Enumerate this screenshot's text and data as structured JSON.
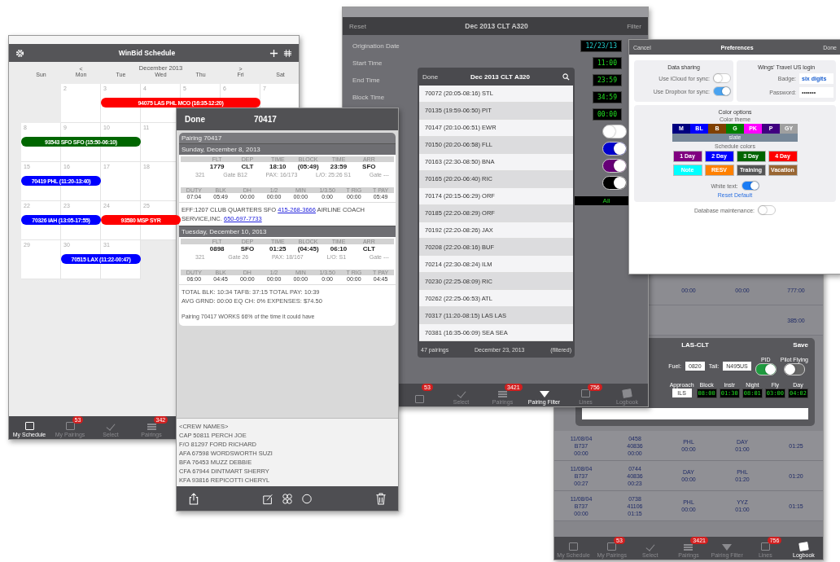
{
  "logbook": {
    "summary_rows": [
      {
        "values": [
          "00:00",
          "00:00",
          "777:00"
        ]
      },
      {
        "values": [
          "385:00"
        ]
      }
    ],
    "dialog": {
      "title": "LAS-CLT",
      "save": "Save",
      "fields": [
        {
          "label": "Fuel:",
          "value": "0820"
        },
        {
          "label": "Tail:",
          "value": "N495US"
        }
      ],
      "switches": [
        {
          "label": "PID",
          "on": true
        },
        {
          "label": "Pilot Flying",
          "on": false
        }
      ],
      "times": [
        {
          "kind": "field",
          "label": "Approach",
          "value": "ILS"
        },
        {
          "kind": "digital",
          "label": "Block",
          "value": "08:00"
        },
        {
          "kind": "digital",
          "label": "Instr",
          "value": "01:30"
        },
        {
          "kind": "digital",
          "label": "Night",
          "value": "08:01"
        },
        {
          "kind": "digital",
          "label": "Fly",
          "value": "03:00"
        },
        {
          "kind": "digital",
          "label": "Day",
          "value": "04:02"
        }
      ]
    },
    "rows": [
      {
        "cells": [
          [
            "11/08/04",
            "B737",
            "00:00"
          ],
          [
            "0458",
            "40836",
            "00:00"
          ],
          [
            "PHL",
            "00:00"
          ],
          [
            "DAY",
            "01:00"
          ],
          [
            "01:25"
          ]
        ]
      },
      {
        "cells": [
          [
            "11/08/04",
            "B737",
            "00:27"
          ],
          [
            "0744",
            "40836",
            "00:23"
          ],
          [
            "DAY",
            "00:00"
          ],
          [
            "PHL",
            "01:20"
          ],
          [
            "01:20"
          ]
        ]
      },
      {
        "cells": [
          [
            "11/08/04",
            "B737",
            "00:00"
          ],
          [
            "0738",
            "41106",
            "01:15"
          ],
          [
            "PHL",
            "00:00"
          ],
          [
            "YYZ",
            "01:00"
          ],
          [
            "01:15"
          ]
        ]
      }
    ],
    "tab_bar": [
      {
        "kind": "schedule",
        "label": "My Schedule",
        "selected": false
      },
      {
        "kind": "pairings",
        "label": "My Pairings",
        "badge": "53",
        "selected": false
      },
      {
        "kind": "select",
        "label": "Select",
        "selected": false
      },
      {
        "kind": "list",
        "label": "Pairings",
        "badge": "3421",
        "selected": false
      },
      {
        "kind": "filter",
        "label": "Pairing Filter",
        "selected": false
      },
      {
        "kind": "lines",
        "label": "Lines",
        "badge": "756",
        "selected": false
      },
      {
        "kind": "logbook",
        "label": "Logbook",
        "selected": true
      }
    ]
  },
  "filter_screen": {
    "reset": "Reset",
    "title": "Dec 2013 CLT A320",
    "filter": "Filter",
    "fields": [
      {
        "label": "Origination Date",
        "value": "12/23/13"
      },
      {
        "label": "Start Time",
        "value": "11:00"
      },
      {
        "label": "End Time",
        "value": "23:59"
      },
      {
        "label": "Block Time",
        "value": "34:59"
      },
      {
        "value": "00:00"
      }
    ],
    "switches": [
      {
        "on": false
      },
      {
        "on": true,
        "color": "#0000cc"
      },
      {
        "on": true,
        "color": "#660077"
      },
      {
        "on": true,
        "color": "#000000"
      }
    ],
    "all_button": "All",
    "pairing_list": {
      "done": "Done",
      "title": "Dec 2013 CLT A320",
      "rows": [
        "70072 (20:05-08:16) STL",
        "70135 (19:59-06:50) PIT",
        "70147 (20:10-06:51) EWR",
        "70150 (20:20-06:58) FLL",
        "70163 (22:30-08:50) BNA",
        "70165 (20:20-06:40) RIC",
        "70174 (20:15-06:29) ORF",
        "70185 (22:20-08:29) ORF",
        "70192 (22:20-08:26) JAX",
        "70208 (22:20-08:16) BUF",
        "70214 (22:30-08:24) ILM",
        "70230 (22:25-08:09) RIC",
        "70262 (22:25-06:53) ATL",
        "70317 (11:20-08:15) LAS LAS",
        "70381 (16:35-06:09) SEA SEA"
      ],
      "count": "47 pairings",
      "date": "December 23, 2013",
      "status": "(filtered)"
    },
    "tab_bar": [
      {
        "kind": "pairings",
        "badge": "53",
        "selected": false
      },
      {
        "kind": "select",
        "label": "Select",
        "selected": false
      },
      {
        "kind": "list",
        "label": "Pairings",
        "badge": "3421",
        "selected": false
      },
      {
        "kind": "filter",
        "label": "Pairing Filter",
        "selected": true
      },
      {
        "kind": "lines",
        "label": "Lines",
        "badge": "756",
        "selected": false
      },
      {
        "kind": "logbook",
        "label": "Logbook",
        "selected": false
      }
    ]
  },
  "calendar": {
    "title": "WinBid Schedule",
    "prev": "<",
    "month": "December 2013",
    "next": ">",
    "weekdays": [
      "Sun",
      "Mon",
      "Tue",
      "Wed",
      "Thu",
      "Fri",
      "Sat"
    ],
    "weeks": [
      {
        "cells": [
          {
            "kind": "blank"
          },
          {
            "kind": "day",
            "day": "2"
          },
          {
            "kind": "day",
            "day": "3",
            "bar": {
              "label": "94075 LAS PHL MCO (16:35-12:20)",
              "color": "#ff0000"
            }
          },
          {
            "kind": "day",
            "day": "4",
            "bar_continues": true
          },
          {
            "kind": "day",
            "day": "5",
            "bar_continues": true
          },
          {
            "kind": "day",
            "day": "6",
            "bar_continues": true
          },
          {
            "kind": "day",
            "day": "7"
          }
        ]
      },
      {
        "cells": [
          {
            "kind": "day",
            "day": "8",
            "bar": {
              "label": "93543 SFO SFO (15:50-06:10)",
              "color": "#006600"
            }
          },
          {
            "kind": "day",
            "day": "9",
            "bar_continues": true
          },
          {
            "kind": "day",
            "day": "10",
            "bar_continues": true
          },
          {
            "kind": "day",
            "day": "11"
          }
        ]
      },
      {
        "cells": [
          {
            "kind": "day",
            "day": "15",
            "bar": {
              "label": "70419 PHL (11:20-13:40)",
              "color": "#0000ff"
            }
          },
          {
            "kind": "day",
            "day": "16",
            "bar_continues": true
          },
          {
            "kind": "day",
            "day": "17"
          },
          {
            "kind": "day",
            "day": "18"
          }
        ]
      },
      {
        "cells": [
          {
            "kind": "day",
            "day": "22",
            "bar": {
              "label": "70326 IAH (13:05-17:55)",
              "color": "#0000ff"
            }
          },
          {
            "kind": "day",
            "day": "23",
            "bar_continues": true
          },
          {
            "kind": "day",
            "day": "24",
            "bar": {
              "label": "93580 MSP SYR",
              "color": "#ff0000"
            }
          },
          {
            "kind": "day",
            "day": "25",
            "bar_continues": true
          }
        ]
      },
      {
        "cells": [
          {
            "kind": "day",
            "day": "29"
          },
          {
            "kind": "day",
            "day": "30",
            "bar": {
              "label": "70515 LAX (11:22-00:47)",
              "color": "#0000ff"
            }
          },
          {
            "kind": "day",
            "day": "31",
            "bar_continues": true
          },
          {
            "kind": "blank"
          },
          {
            "kind": "blank"
          },
          {
            "kind": "blank"
          },
          {
            "kind": "blank"
          }
        ]
      }
    ],
    "tab_bar": [
      {
        "kind": "schedule",
        "label": "My Schedule",
        "selected": true
      },
      {
        "kind": "pairings",
        "label": "My Pairings",
        "badge": "53",
        "selected": false
      },
      {
        "kind": "select",
        "label": "Select",
        "selected": false
      },
      {
        "kind": "list",
        "label": "Pairings",
        "badge": "342",
        "selected": false
      }
    ]
  },
  "pairing_detail": {
    "done": "Done",
    "title": "70417",
    "pairing": "Pairing 70417",
    "days": [
      {
        "date": "Sunday, December 8, 2013",
        "leg_headers": [
          "FLT",
          "DEP",
          "TIME",
          "BLOCK",
          "TIME",
          "ARR"
        ],
        "leg": [
          "1779",
          "CLT",
          "18:10",
          "(05:49)",
          "23:59",
          "SFO"
        ],
        "leg_info": [
          "321",
          "Gate B12",
          "PAX: 16/173",
          "L/O: 25:26 S1",
          "Gate ---"
        ],
        "duty_headers": [
          "DUTY",
          "BLK",
          "DH",
          "1/2",
          "MIN",
          "1/3.50",
          "T RIG",
          "T PAY"
        ],
        "duty": [
          "07:04",
          "05:49",
          "00:00",
          "00:00",
          "00:00",
          "0:00",
          "00:00",
          "05:49"
        ],
        "note": [
          {
            "kind": "text",
            "text": "EFF:1207 CLUB QUARTERS SFO "
          },
          {
            "kind": "link",
            "text": "415-268-3666"
          },
          {
            "kind": "text",
            "text": " AIRLINE COACH SERVICE,INC. "
          },
          {
            "kind": "link",
            "text": "650-697-7733"
          }
        ]
      },
      {
        "date": "Tuesday, December 10, 2013",
        "leg_headers": [
          "FLT",
          "DEP",
          "TIME",
          "BLOCK",
          "TIME",
          "ARR"
        ],
        "leg": [
          "0898",
          "SFO",
          "01:25",
          "(04:45)",
          "06:10",
          "CLT"
        ],
        "leg_info": [
          "321",
          "Gate 26",
          "PAX: 18/167",
          "L/O: S1",
          "Gate ---"
        ],
        "duty_headers": [
          "DUTY",
          "BLK",
          "DH",
          "1/2",
          "MIN",
          "1/3.50",
          "T RIG",
          "T PAY"
        ],
        "duty": [
          "06:00",
          "04:45",
          "00:00",
          "00:00",
          "00:00",
          "0:00",
          "00:00",
          "04:45"
        ]
      }
    ],
    "totals": [
      "TOTAL BLK: 10:34  TAFB: 37:15  TOTAL PAY: 10:39",
      "AVG GRND: 00:00  EQ CH: 0%  EXPENSES: $74.50"
    ],
    "summary": "Pairing 70417 WORKS 66% of the time it could have",
    "crew": [
      "<CREW NAMES>",
      "CAP 50811 PERCH JOE",
      "F/O 81297 FORD RICHARD",
      "AFA 67598 WORDSWORTH SUZI",
      "BFA 76453 MUZZ DEBBIE",
      "CFA 67944 DINTMART SHERRY",
      "KFA 93816 REPICOTTI CHERYL"
    ]
  },
  "preferences": {
    "cancel": "Cancel",
    "title": "Preferences",
    "done": "Done",
    "data_sharing": {
      "title": "Data sharing",
      "switches": [
        {
          "label": "Use iCloud for sync:",
          "on": false
        },
        {
          "label": "Use Dropbox for sync:",
          "on": true
        }
      ]
    },
    "login": {
      "title": "Wings' Travel US login",
      "fields": [
        {
          "label": "Badge:",
          "value": "six digits"
        },
        {
          "label": "Password:",
          "value": "•••••••"
        }
      ]
    },
    "color_options": {
      "title": "Color options",
      "theme_label": "Color theme",
      "theme_swatches": [
        {
          "label": "M",
          "color": "#000080"
        },
        {
          "label": "BL",
          "color": "#0000ff"
        },
        {
          "label": "B",
          "color": "#804000"
        },
        {
          "label": "G",
          "color": "#008000"
        },
        {
          "label": "PK",
          "color": "#ff00ff"
        },
        {
          "label": "P",
          "color": "#400080"
        },
        {
          "label": "GY",
          "color": "#a0a0a0"
        }
      ],
      "theme": {
        "label": "slate",
        "color": "#778899"
      },
      "schedule_label": "Schedule colors",
      "schedule_chips": [
        {
          "label": "1 Day",
          "color": "#800080"
        },
        {
          "label": "2 Day",
          "color": "#0000ff"
        },
        {
          "label": "3 Day",
          "color": "#006400"
        },
        {
          "label": "4 Day",
          "color": "#ff0000"
        },
        {
          "label": "Note",
          "color": "#00ffff"
        },
        {
          "label": "RESV",
          "color": "#ff8000"
        },
        {
          "label": "Training",
          "color": "#555555"
        },
        {
          "label": "Vacation",
          "color": "#996633"
        }
      ],
      "white_text": {
        "label": "White text:",
        "on": true
      },
      "reset": "Reset Default"
    },
    "database": {
      "label": "Database maintenance:",
      "on": false
    }
  }
}
